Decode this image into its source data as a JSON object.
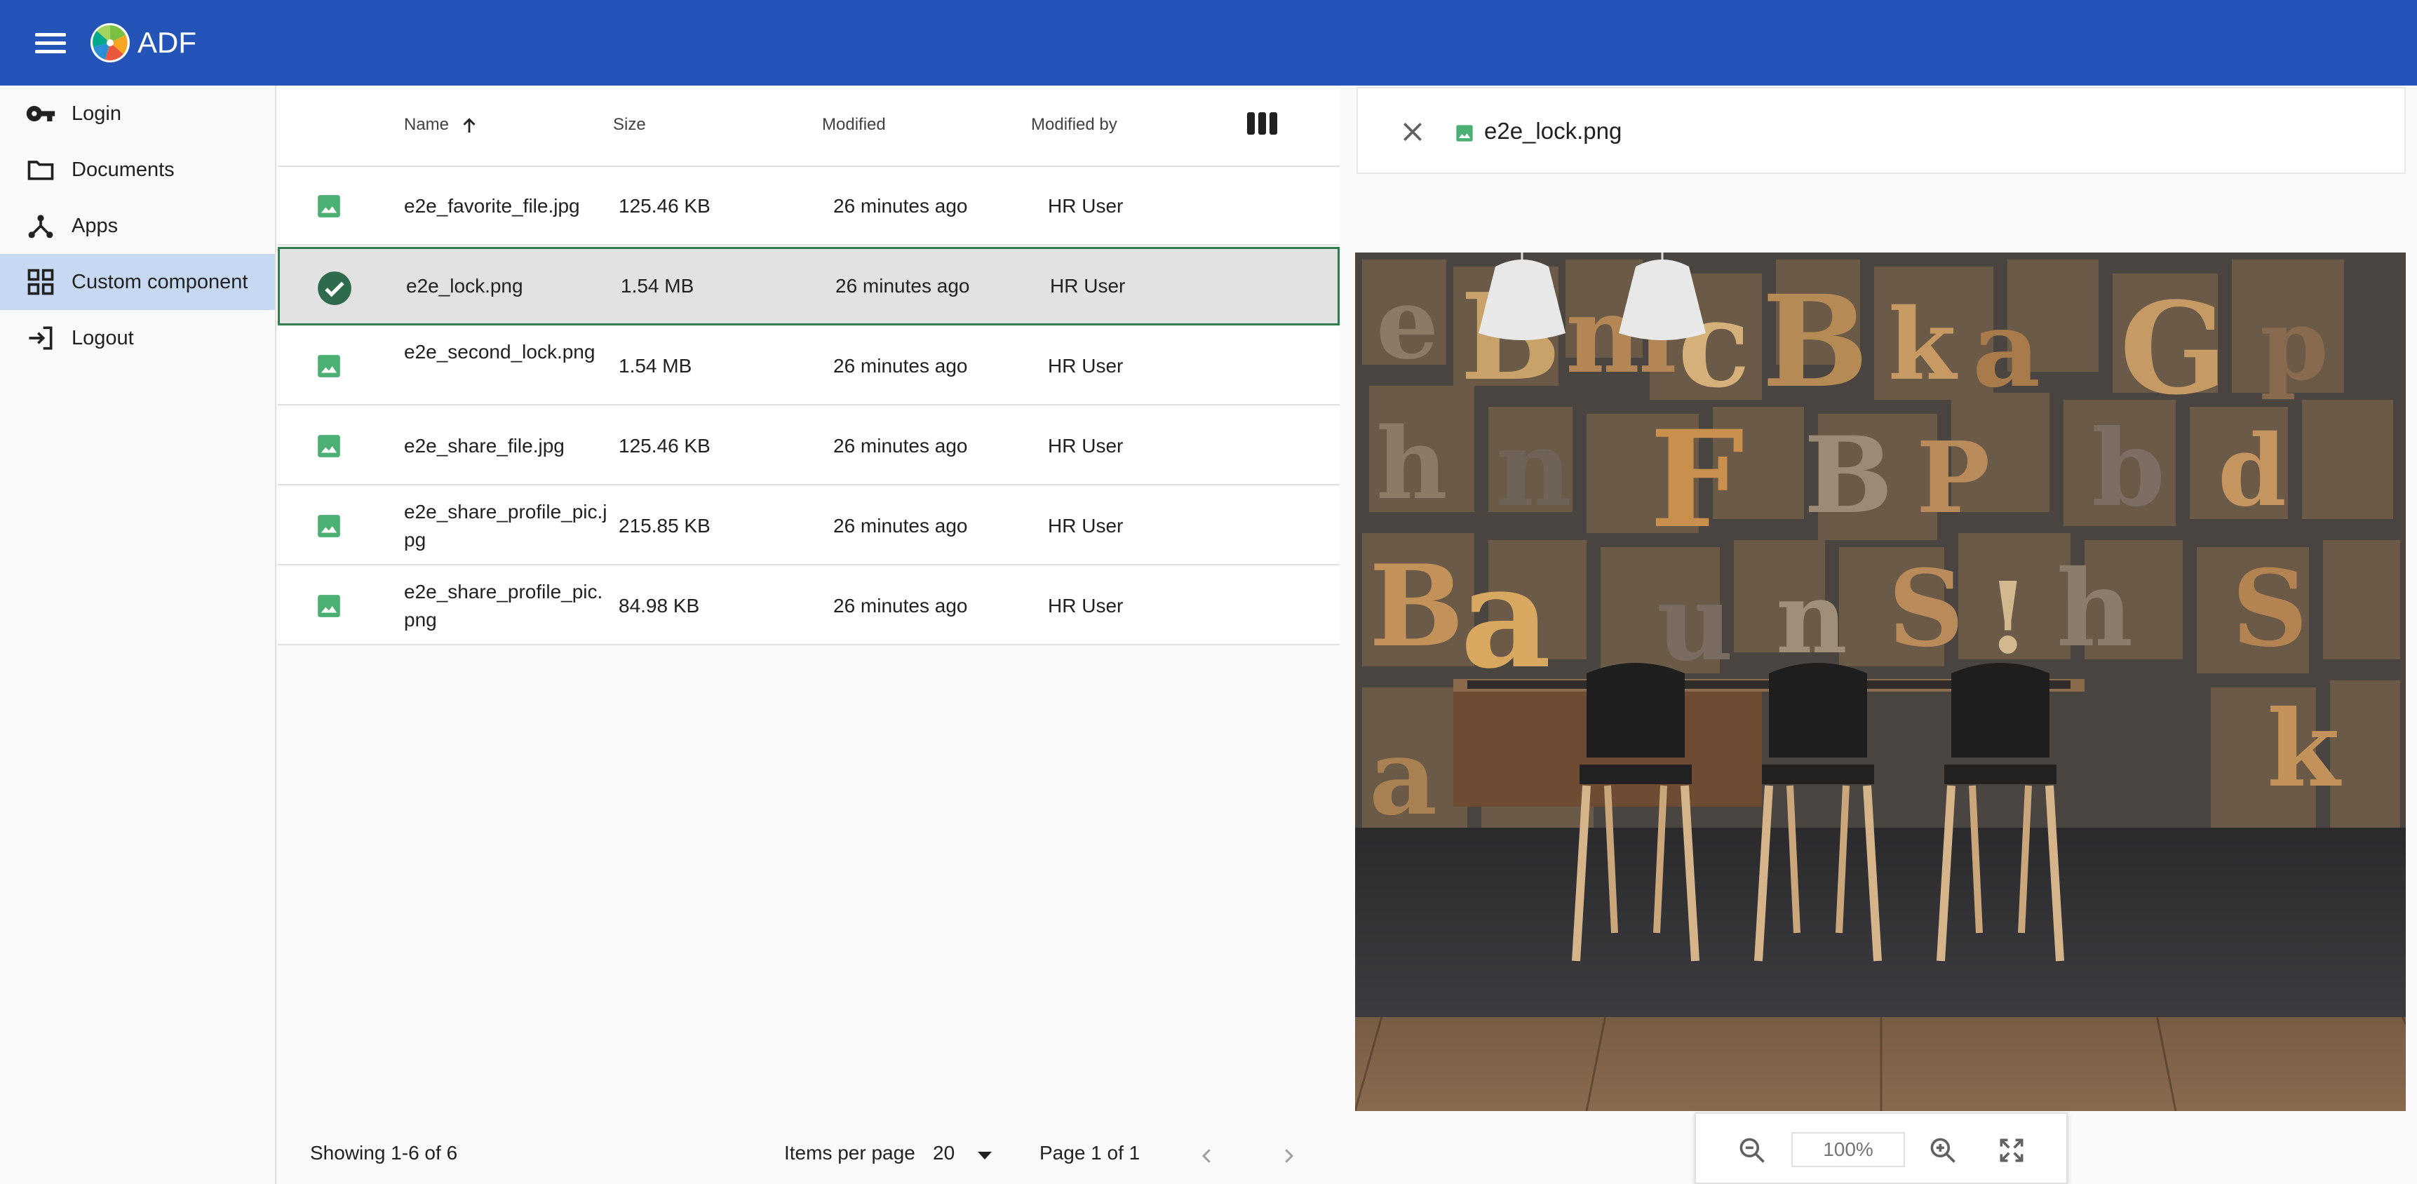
{
  "header": {
    "title": "ADF",
    "menu_icon": "menu-icon",
    "logo_icon": "alfresco-logo-icon",
    "background": "#2454b8"
  },
  "sidebar": {
    "items": [
      {
        "label": "Login",
        "icon": "key-icon"
      },
      {
        "label": "Documents",
        "icon": "folder-icon"
      },
      {
        "label": "Apps",
        "icon": "apps-hub-icon"
      },
      {
        "label": "Custom component",
        "icon": "grid-icon",
        "active": true
      },
      {
        "label": "Logout",
        "icon": "exit-icon"
      }
    ]
  },
  "doclist": {
    "columns": {
      "name": "Name",
      "size": "Size",
      "modified": "Modified",
      "modified_by": "Modified by"
    },
    "sort": {
      "column": "Name",
      "direction": "ascending"
    },
    "rows": [
      {
        "name": "e2e_favorite_file.jpg",
        "size": "125.46 KB",
        "modified": "26 minutes ago",
        "modified_by": "HR User",
        "selected": false
      },
      {
        "name": "e2e_lock.png",
        "size": "1.54 MB",
        "modified": "26 minutes ago",
        "modified_by": "HR User",
        "selected": true
      },
      {
        "name": "e2e_second_lock.png",
        "size": "1.54 MB",
        "modified": "26 minutes ago",
        "modified_by": "HR User",
        "selected": false
      },
      {
        "name": "e2e_share_file.jpg",
        "size": "125.46 KB",
        "modified": "26 minutes ago",
        "modified_by": "HR User",
        "selected": false
      },
      {
        "name": "e2e_share_profile_pic.jpg",
        "size": "215.85 KB",
        "modified": "26 minutes ago",
        "modified_by": "HR User",
        "selected": false
      },
      {
        "name": "e2e_share_profile_pic.png",
        "size": "84.98 KB",
        "modified": "26 minutes ago",
        "modified_by": "HR User",
        "selected": false
      }
    ],
    "pagination": {
      "range": "Showing 1-6 of 6",
      "items_per_page_label": "Items per page",
      "items_per_page_value": "20",
      "page": "Page 1 of 1"
    }
  },
  "viewer": {
    "file_name": "e2e_lock.png",
    "zoom": "100%",
    "toolbar": {
      "zoom_out_icon": "zoom-out-icon",
      "zoom_in_icon": "zoom-in-icon",
      "fullscreen_icon": "fullscreen-icon"
    }
  },
  "colors": {
    "accent": "#2454b8",
    "active_nav": "#c7d8f2",
    "file_icon": "#4caf73",
    "selected_check": "#2e6b4c"
  }
}
